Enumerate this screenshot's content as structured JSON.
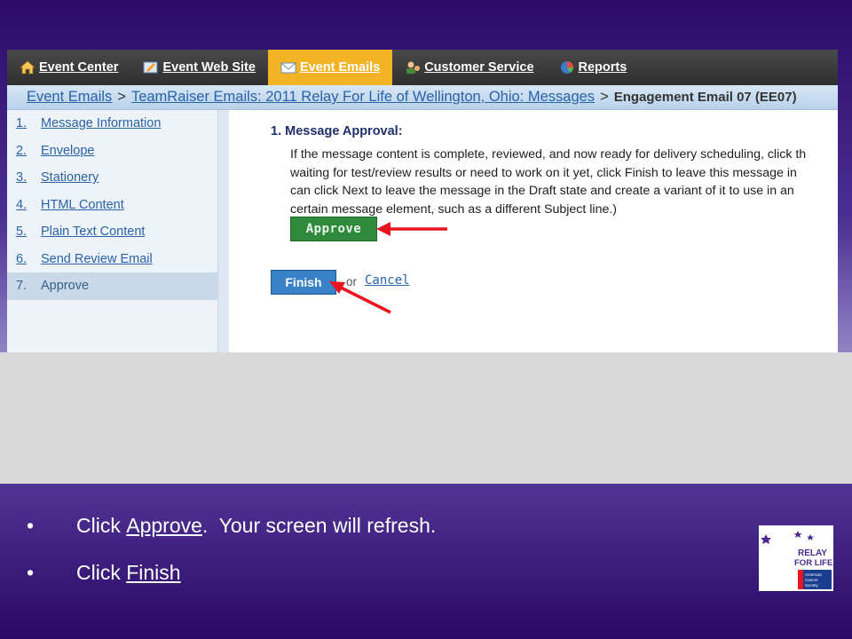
{
  "nav": {
    "items": [
      {
        "label": "Event Center",
        "icon": "home-icon"
      },
      {
        "label": "Event Web Site",
        "icon": "website-icon"
      },
      {
        "label": "Event Emails",
        "icon": "email-icon",
        "active": true
      },
      {
        "label": "Customer Service",
        "icon": "customer-service-icon"
      },
      {
        "label": "Reports",
        "icon": "reports-icon"
      }
    ]
  },
  "breadcrumb": {
    "items": [
      "Event Emails",
      "TeamRaiser Emails: 2011 Relay For Life of Wellington, Ohio: Messages"
    ],
    "separator": ">",
    "current": "Engagement Email 07 (EE07)"
  },
  "sidebar": {
    "steps": [
      {
        "num": "1.",
        "label": "Message Information"
      },
      {
        "num": "2.",
        "label": "Envelope"
      },
      {
        "num": "3.",
        "label": "Stationery"
      },
      {
        "num": "4.",
        "label": "HTML Content"
      },
      {
        "num": "5.",
        "label": "Plain Text Content"
      },
      {
        "num": "6.",
        "label": "Send Review Email"
      },
      {
        "num": "7.",
        "label": "Approve",
        "current": true
      }
    ]
  },
  "main": {
    "title": "1.  Message Approval:",
    "lines": [
      "If the message content is complete, reviewed, and now ready for delivery scheduling, click th",
      "waiting for test/review results or need to work on it yet, click Finish to leave this message in",
      "can click Next to leave the message in the Draft state and create a variant of it to use in an",
      "certain message element, such as a different Subject line.)"
    ],
    "approve_label": "Approve",
    "finish_label": "Finish",
    "or_text": "or",
    "cancel_label": "Cancel"
  },
  "instructions": [
    {
      "bullet": "•",
      "before": "Click ",
      "link": "Approve",
      "after": ".  Your screen will refresh."
    },
    {
      "bullet": "•",
      "before": "Click ",
      "link": "Finish",
      "after": ""
    }
  ],
  "logo": {
    "text_line1": "RELAY",
    "text_line2": "FOR LIFE",
    "org": [
      "American",
      "Cancer",
      "Society"
    ]
  },
  "colors": {
    "arrow": "#e8141e",
    "nav_active": "#f3b324",
    "approve": "#2f8a3c",
    "finish": "#3a82c8"
  }
}
